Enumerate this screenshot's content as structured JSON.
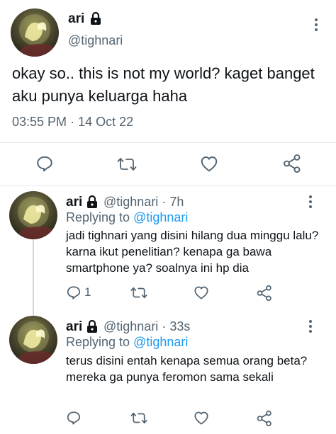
{
  "main_tweet": {
    "name": "ari",
    "handle": "@tighnari",
    "text": "okay so.. this is not my world? kaget banget aku punya keluarga haha",
    "time": "03:55 PM",
    "dot": "·",
    "date": "14 Oct 22"
  },
  "replies": [
    {
      "name": "ari",
      "handle": "@tighnari",
      "dot": "·",
      "age": "7h",
      "replying_prefix": "Replying to",
      "replying_to": "@tighnari",
      "text": "jadi tighnari yang disini hilang dua minggu lalu? karna ikut penelitian? kenapa ga bawa smartphone ya? soalnya ini hp dia",
      "reply_count": "1"
    },
    {
      "name": "ari",
      "handle": "@tighnari",
      "dot": "·",
      "age": "33s",
      "replying_prefix": "Replying to",
      "replying_to": "@tighnari",
      "text": "terus disini entah kenapa semua orang beta? mereka ga punya feromon sama sekali",
      "reply_count": ""
    }
  ],
  "icons": {
    "reply": "reply-bubble-icon",
    "retweet": "retweet-icon",
    "like": "heart-icon",
    "share": "share-icon",
    "lock": "lock-icon",
    "more": "more-vertical-icon"
  },
  "colors": {
    "text": "#0f1419",
    "secondary": "#536471",
    "link": "#1d9bf0",
    "divider": "#e3e7ea"
  }
}
